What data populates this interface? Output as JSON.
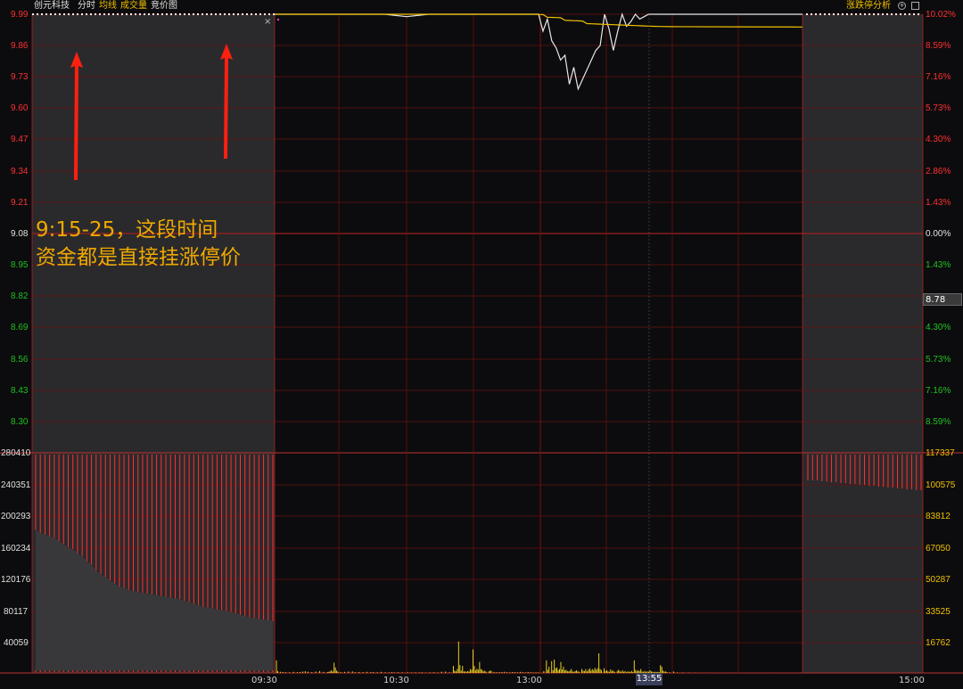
{
  "header": {
    "stock_name": "创元科技",
    "tabs": [
      {
        "label": "分时",
        "color": "#e0e0e0"
      },
      {
        "label": "均线",
        "color": "#f0c000"
      },
      {
        "label": "成交量",
        "color": "#f0c000"
      },
      {
        "label": "竞价图",
        "color": "#e0e0e0"
      }
    ],
    "analysis_label": "涨跌停分析",
    "close_glyph": "×"
  },
  "price_axis": {
    "left_up": [
      "9.99",
      "9.86",
      "9.73",
      "9.60",
      "9.47",
      "9.34",
      "9.21"
    ],
    "left_mid": "9.08",
    "left_down": [
      "8.95",
      "8.82",
      "8.69",
      "8.56",
      "8.43",
      "8.30"
    ],
    "right_up": [
      "10.02%",
      "8.59%",
      "7.16%",
      "5.73%",
      "4.30%",
      "2.86%",
      "1.43%"
    ],
    "right_mid": "0.00%",
    "right_down": [
      "1.43%",
      "4.30%",
      "5.73%",
      "7.16%",
      "8.59%"
    ],
    "current_price": "8.78"
  },
  "volume_axis": {
    "left": [
      "280410",
      "240351",
      "200293",
      "160234",
      "120176",
      "80117",
      "40059"
    ],
    "right": [
      "117337",
      "100575",
      "83812",
      "67050",
      "50287",
      "33525",
      "16762"
    ]
  },
  "time_axis": {
    "labels": [
      "09:30",
      "10:30",
      "13:00",
      "15:00"
    ],
    "cursor_time": "13:55"
  },
  "annotation": {
    "line1": "9:15-25，这段时间",
    "line2": "资金都是直接挂涨停价"
  },
  "colors": {
    "up": "#ff3030",
    "down": "#20c020",
    "neutral": "#e0e0e0",
    "avg_line": "#f0c000",
    "volume": "#e8d020",
    "grid": "#6a1010",
    "arrow": "#ff2010"
  },
  "chart_data": {
    "type": "line",
    "title": "",
    "prev_close": 9.08,
    "limit_up": 9.99,
    "ylim": [
      8.17,
      9.99
    ],
    "x": [
      "09:30",
      "09:40",
      "09:50",
      "10:00",
      "10:10",
      "10:20",
      "10:30",
      "10:40",
      "10:50",
      "11:00",
      "11:10",
      "11:20",
      "11:30",
      "13:00",
      "13:02",
      "13:04",
      "13:06",
      "13:08",
      "13:10",
      "13:12",
      "13:14",
      "13:16",
      "13:18",
      "13:20",
      "13:22",
      "13:24",
      "13:26",
      "13:28",
      "13:30",
      "13:32",
      "13:34",
      "13:36",
      "13:38",
      "13:40",
      "13:42",
      "13:44",
      "13:46",
      "13:48",
      "13:50",
      "13:52",
      "13:55",
      "14:00",
      "14:30",
      "15:00"
    ],
    "series": [
      {
        "values": [
          9.99,
          9.99,
          9.99,
          9.99,
          9.99,
          9.99,
          9.98,
          9.99,
          9.99,
          9.99,
          9.99,
          9.99,
          9.99,
          9.99,
          9.92,
          9.97,
          9.88,
          9.85,
          9.8,
          9.82,
          9.7,
          9.77,
          9.68,
          9.72,
          9.76,
          9.8,
          9.84,
          9.86,
          9.99,
          9.93,
          9.84,
          9.92,
          9.99,
          9.94,
          9.96,
          9.99,
          9.97,
          9.98,
          9.99,
          9.99,
          9.99,
          9.99,
          9.99,
          9.99
        ]
      },
      {
        "values": [
          9.99,
          9.99,
          9.99,
          9.99,
          9.99,
          9.99,
          9.99,
          9.99,
          9.99,
          9.99,
          9.99,
          9.99,
          9.99,
          9.99,
          9.99,
          9.98,
          9.98,
          9.98,
          9.98,
          9.97,
          9.97,
          9.97,
          9.97,
          9.97,
          9.96,
          9.96,
          9.96,
          9.96,
          9.96,
          9.96,
          9.96,
          9.96,
          9.96,
          9.96,
          9.96,
          9.96,
          9.96,
          9.96,
          9.96,
          9.96,
          9.96,
          9.96,
          9.96,
          9.96
        ]
      }
    ],
    "volume_ylim": [
      0,
      280410
    ],
    "auction_volume_morning": [
      182000,
      178000,
      176000,
      174000,
      172000,
      168000,
      164000,
      160000,
      158000,
      152000,
      149000,
      142000,
      138000,
      130000,
      126000,
      122000,
      118000,
      114000,
      110000,
      108000,
      106000,
      104000,
      103000,
      102000,
      101000,
      100000,
      99000,
      98000,
      97000,
      96000,
      95000,
      94000,
      92000,
      90000,
      88000,
      86000,
      84000,
      83000,
      82000,
      81000,
      80000,
      79000,
      78000,
      76000,
      74000,
      72000,
      71000,
      70000,
      69000,
      68000,
      67000,
      66000
    ],
    "auction_volume_close": [
      109000,
      109000,
      109000,
      108000,
      108000,
      107000,
      107000,
      106000,
      106000,
      105000,
      105000,
      104000,
      104000,
      103000,
      103000,
      102000,
      102000,
      101000,
      101000,
      100000,
      100000,
      99000,
      99000,
      98000,
      98000
    ],
    "trading_volume": [
      [
        0.0,
        16000
      ],
      [
        0.01,
        2500
      ],
      [
        0.03,
        1500
      ],
      [
        0.05,
        1200
      ],
      [
        0.07,
        1000
      ],
      [
        0.1,
        900
      ],
      [
        0.13,
        1400
      ],
      [
        0.16,
        1000
      ],
      [
        0.18,
        1200
      ],
      [
        0.2,
        1800
      ],
      [
        0.22,
        2200
      ],
      [
        0.24,
        1500
      ],
      [
        0.27,
        1000
      ],
      [
        0.3,
        1800
      ],
      [
        0.33,
        2500
      ],
      [
        0.36,
        1400
      ],
      [
        0.39,
        1100
      ],
      [
        0.4,
        1500
      ],
      [
        0.41,
        2000
      ],
      [
        0.42,
        3500
      ],
      [
        0.43,
        1800
      ],
      [
        0.44,
        13000
      ],
      [
        0.45,
        7000
      ],
      [
        0.46,
        3000
      ],
      [
        0.47,
        1500
      ],
      [
        0.49,
        1200
      ],
      [
        0.52,
        1400
      ],
      [
        0.55,
        1800
      ],
      [
        0.58,
        2000
      ],
      [
        0.6,
        1000
      ],
      [
        0.63,
        1200
      ],
      [
        0.66,
        1000
      ],
      [
        0.69,
        1400
      ],
      [
        0.72,
        1000
      ],
      [
        0.74,
        1200
      ],
      [
        0.77,
        900
      ],
      [
        0.8,
        1400
      ],
      [
        0.83,
        800
      ],
      [
        0.86,
        600
      ],
      [
        0.88,
        1000
      ],
      [
        0.9,
        700
      ],
      [
        0.93,
        900
      ],
      [
        0.96,
        700
      ],
      [
        1.0,
        900
      ],
      [
        1.03,
        600
      ],
      [
        1.06,
        700
      ],
      [
        1.09,
        600
      ],
      [
        1.11,
        800
      ],
      [
        1.14,
        400
      ],
      [
        1.17,
        700
      ],
      [
        1.2,
        900
      ],
      [
        1.23,
        500
      ],
      [
        1.26,
        1500
      ],
      [
        1.29,
        1800
      ],
      [
        1.32,
        800
      ],
      [
        1.35,
        9000
      ],
      [
        1.36,
        3000
      ],
      [
        1.37,
        2000
      ],
      [
        1.38,
        5000
      ],
      [
        1.39,
        40000
      ],
      [
        1.4,
        10000
      ],
      [
        1.41,
        3000
      ],
      [
        1.42,
        9000
      ],
      [
        1.43,
        2000
      ],
      [
        1.44,
        2000
      ],
      [
        1.45,
        1500
      ],
      [
        1.46,
        2500
      ],
      [
        1.47,
        1800
      ],
      [
        1.48,
        5000
      ],
      [
        1.49,
        4000
      ],
      [
        1.5,
        30000
      ],
      [
        1.51,
        9000
      ],
      [
        1.52,
        3500
      ],
      [
        1.53,
        5500
      ],
      [
        1.54,
        4000
      ],
      [
        1.55,
        14000
      ],
      [
        1.56,
        5000
      ],
      [
        1.57,
        4000
      ],
      [
        1.58,
        2000
      ],
      [
        1.59,
        3000
      ],
      [
        1.6,
        1500
      ],
      [
        1.62,
        2000
      ],
      [
        1.63,
        3000
      ],
      [
        1.64,
        2500
      ],
      [
        1.66,
        1200
      ],
      [
        1.68,
        1000
      ],
      [
        1.7,
        900
      ],
      [
        1.72,
        1200
      ],
      [
        1.74,
        1500
      ],
      [
        1.76,
        900
      ],
      [
        1.78,
        700
      ],
      [
        1.8,
        1200
      ],
      [
        1.82,
        1000
      ],
      [
        1.84,
        800
      ],
      [
        1.86,
        1400
      ],
      [
        1.88,
        900
      ],
      [
        1.9,
        700
      ],
      [
        1.92,
        1200
      ],
      [
        1.94,
        900
      ],
      [
        1.96,
        600
      ],
      [
        1.98,
        800
      ],
      [
        2.0,
        700
      ],
      [
        2.04,
        2500
      ],
      [
        2.06,
        16000
      ],
      [
        2.07,
        4000
      ],
      [
        2.08,
        8000
      ],
      [
        2.1,
        15000
      ],
      [
        2.11,
        3500
      ],
      [
        2.12,
        17000
      ],
      [
        2.13,
        6000
      ],
      [
        2.14,
        7000
      ],
      [
        2.15,
        3500
      ],
      [
        2.16,
        5000
      ],
      [
        2.17,
        14000
      ],
      [
        2.18,
        4500
      ],
      [
        2.19,
        8000
      ],
      [
        2.2,
        3500
      ],
      [
        2.21,
        4000
      ],
      [
        2.22,
        2500
      ],
      [
        2.23,
        2000
      ],
      [
        2.24,
        3000
      ],
      [
        2.25,
        5000
      ],
      [
        2.26,
        2000
      ],
      [
        2.27,
        1500
      ],
      [
        2.28,
        2500
      ],
      [
        2.29,
        3500
      ],
      [
        2.3,
        2000
      ],
      [
        2.31,
        1500
      ],
      [
        2.33,
        5000
      ],
      [
        2.34,
        3000
      ],
      [
        2.35,
        2500
      ],
      [
        2.36,
        5000
      ],
      [
        2.37,
        2000
      ],
      [
        2.38,
        4000
      ],
      [
        2.39,
        6000
      ],
      [
        2.4,
        3000
      ],
      [
        2.41,
        5000
      ],
      [
        2.42,
        3500
      ],
      [
        2.43,
        6500
      ],
      [
        2.44,
        4000
      ],
      [
        2.45,
        6000
      ],
      [
        2.46,
        25000
      ],
      [
        2.47,
        5000
      ],
      [
        2.48,
        3500
      ],
      [
        2.5,
        6000
      ],
      [
        2.51,
        2500
      ],
      [
        2.52,
        3500
      ],
      [
        2.53,
        2000
      ],
      [
        2.54,
        1500
      ],
      [
        2.55,
        4500
      ],
      [
        2.56,
        2500
      ],
      [
        2.57,
        3000
      ],
      [
        2.58,
        1500
      ],
      [
        2.6,
        2500
      ],
      [
        2.61,
        4000
      ],
      [
        2.62,
        2500
      ],
      [
        2.63,
        1500
      ],
      [
        2.64,
        3500
      ],
      [
        2.65,
        1500
      ],
      [
        2.66,
        2500
      ],
      [
        2.67,
        1000
      ],
      [
        2.68,
        2000
      ],
      [
        2.69,
        1500
      ],
      [
        2.7,
        1500
      ],
      [
        2.71,
        2500
      ],
      [
        2.72,
        1200
      ],
      [
        2.73,
        16000
      ],
      [
        2.74,
        4000
      ],
      [
        2.75,
        2500
      ],
      [
        2.76,
        3500
      ],
      [
        2.77,
        2500
      ],
      [
        2.78,
        5000
      ],
      [
        2.79,
        2000
      ],
      [
        2.8,
        1500
      ],
      [
        2.81,
        2500
      ],
      [
        2.82,
        1500
      ],
      [
        2.83,
        2000
      ],
      [
        2.84,
        1500
      ],
      [
        2.85,
        3500
      ],
      [
        2.86,
        2000
      ],
      [
        2.87,
        1500
      ],
      [
        2.88,
        1000
      ],
      [
        2.89,
        1500
      ],
      [
        2.9,
        1000
      ],
      [
        2.91,
        1500
      ],
      [
        2.92,
        1000
      ],
      [
        2.93,
        10000
      ],
      [
        2.94,
        8000
      ],
      [
        2.95,
        3000
      ],
      [
        2.96,
        1500
      ],
      [
        2.97,
        2000
      ],
      [
        2.98,
        1000
      ],
      [
        3.0,
        900
      ],
      [
        3.03,
        1800
      ],
      [
        3.06,
        700
      ],
      [
        3.1,
        500
      ],
      [
        3.15,
        400
      ],
      [
        3.2,
        300
      ],
      [
        3.3,
        200
      ],
      [
        3.5,
        150
      ],
      [
        3.8,
        120
      ],
      [
        4.0,
        100
      ]
    ]
  }
}
